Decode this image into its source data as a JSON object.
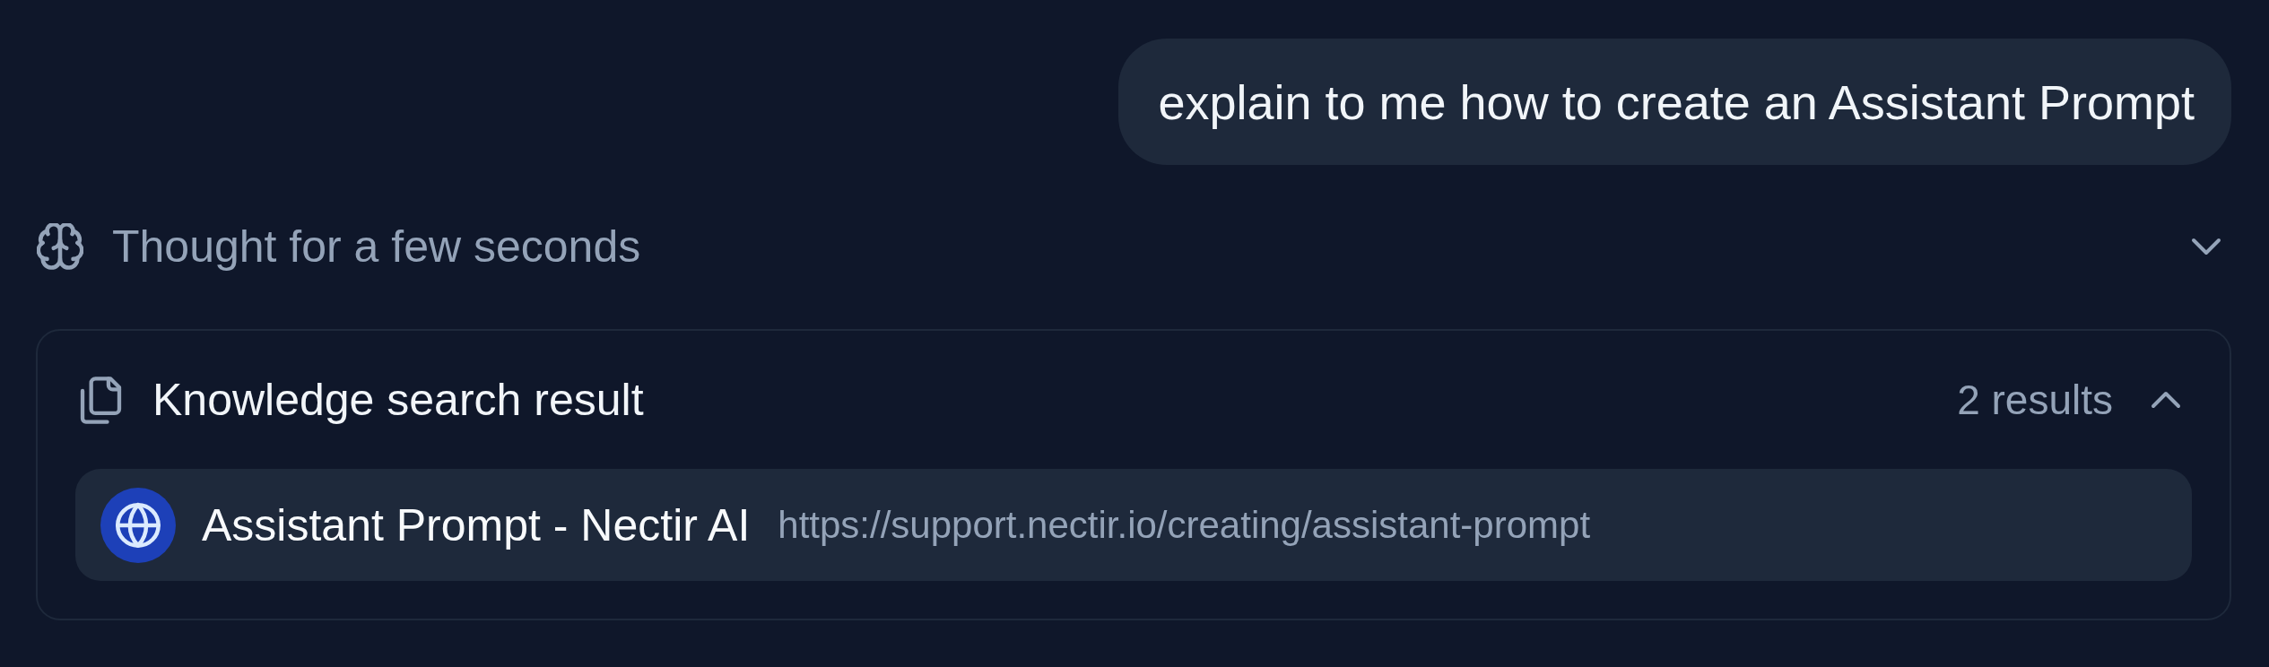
{
  "user_message": {
    "text": "explain to me how to create an Assistant Prompt"
  },
  "thought": {
    "label": "Thought for a few seconds",
    "expanded": false
  },
  "knowledge_search": {
    "title": "Knowledge search result",
    "count": "2 results",
    "expanded": true,
    "results": [
      {
        "title": "Assistant Prompt - Nectir AI",
        "url": "https://support.nectir.io/creating/assistant-prompt"
      }
    ]
  }
}
